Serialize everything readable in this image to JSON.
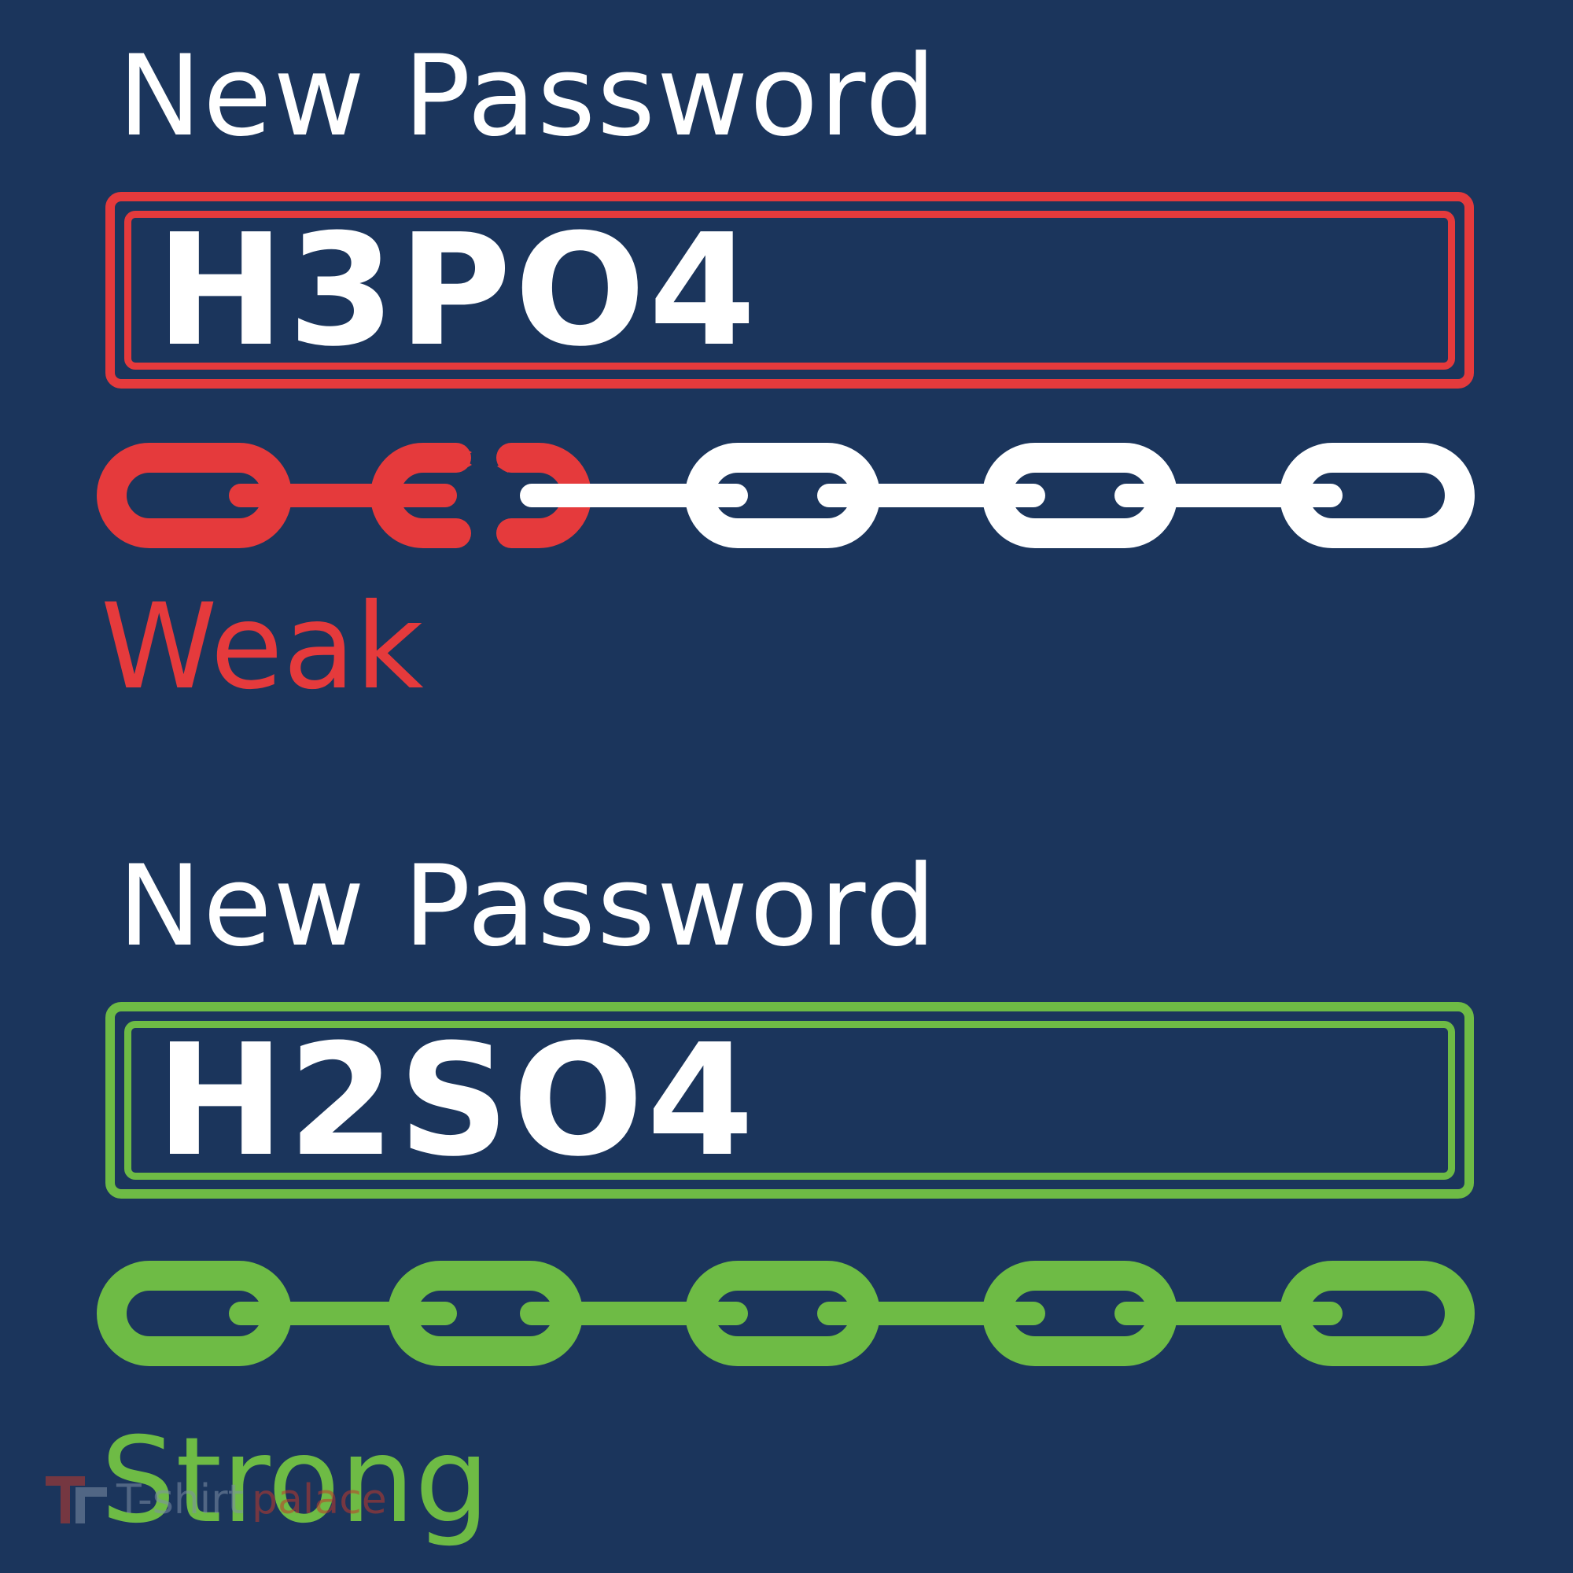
{
  "top_panel": {
    "label": "New Password",
    "password_value": "H3PO4",
    "strength_label": "Weak",
    "strength_color": "#e53a3c",
    "chain_links_total": 5,
    "chain_links_intact": 1,
    "chain_broken": true
  },
  "bottom_panel": {
    "label": "New Password",
    "password_value": "H2SO4",
    "strength_label": "Strong",
    "strength_color": "#6ebb45",
    "chain_links_total": 5,
    "chain_links_intact": 5,
    "chain_broken": false
  },
  "watermark": {
    "part1": "T-shirt",
    "part2": "palace",
    "icon": "tp-logo-icon"
  },
  "colors": {
    "background": "#1b355c",
    "text": "#ffffff",
    "weak": "#e53a3c",
    "strong": "#6ebb45"
  }
}
